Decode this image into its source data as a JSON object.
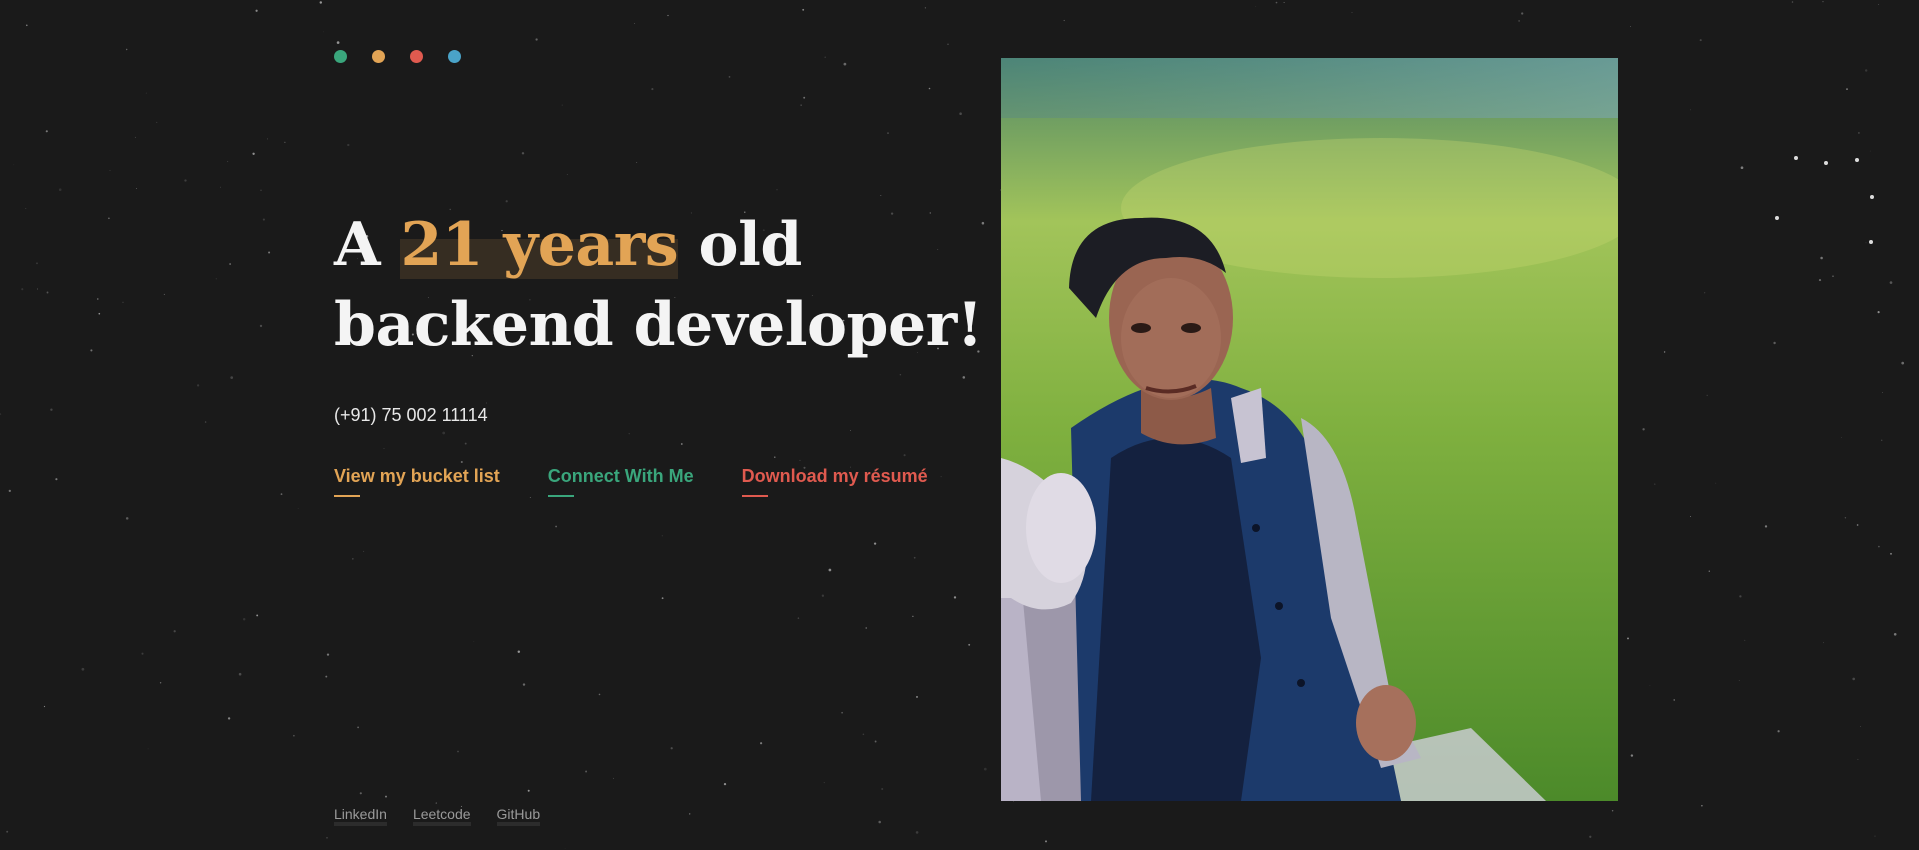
{
  "header": {
    "dots": [
      {
        "name": "green-dot",
        "color": "#3aa67c"
      },
      {
        "name": "orange-dot",
        "color": "#e2a455"
      },
      {
        "name": "red-dot",
        "color": "#e05a4f"
      },
      {
        "name": "blue-dot",
        "color": "#4aa3c8"
      }
    ]
  },
  "hero": {
    "line1_prefix": "A ",
    "highlight": "21 years",
    "line1_suffix": " old",
    "line2": "backend developer!",
    "phone": "(+91) 75 002 11114",
    "accent_color": "#e2a455"
  },
  "links": {
    "bucket_list": "View my bucket list",
    "connect": "Connect With Me",
    "resume": "Download my résumé"
  },
  "social": {
    "linkedin": "LinkedIn",
    "leetcode": "Leetcode",
    "github": "GitHub"
  },
  "photo": {
    "icon": "portrait-photo"
  },
  "theme": {
    "background": "#1a1a1a",
    "green": "#3aa67c",
    "orange": "#e2a455",
    "red": "#e05a4f",
    "blue": "#4aa3c8"
  }
}
